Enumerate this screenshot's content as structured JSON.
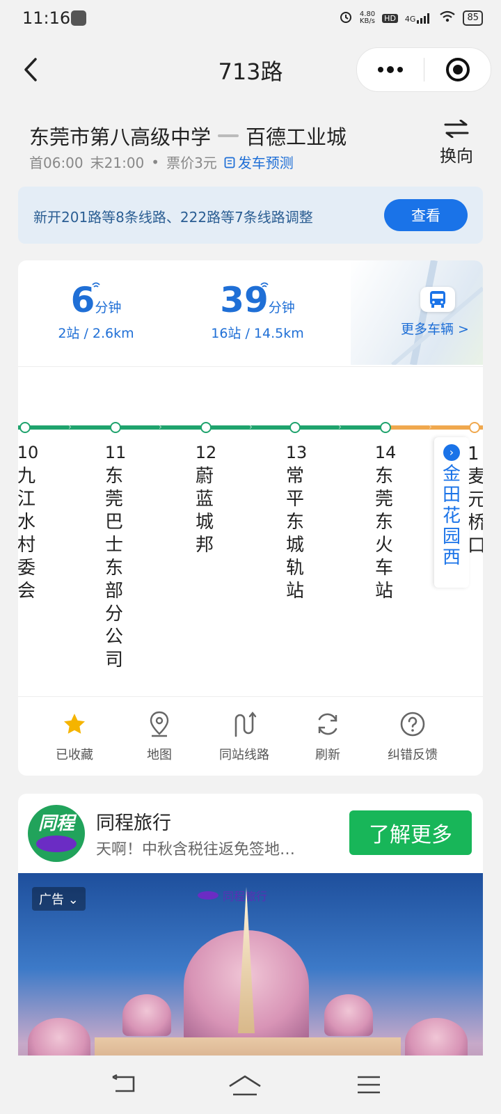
{
  "status_bar": {
    "time": "11:16",
    "net_speed": "4.80\nKB/s",
    "hd": "HD",
    "network": "4G",
    "battery": "85"
  },
  "header": {
    "title": "713路"
  },
  "route": {
    "from": "东莞市第八高级中学",
    "to": "百德工业城",
    "first_bus": "首06:00",
    "last_bus": "末21:00",
    "dot": "•",
    "fare": "票价3元",
    "forecast_label": "发车预测",
    "swap_label": "换向"
  },
  "notice": {
    "text": "新开201路等8条线路、222路等7条线路调整",
    "button": "查看"
  },
  "arrivals": [
    {
      "minutes": "6",
      "unit": "分钟",
      "detail": "2站 / 2.6km"
    },
    {
      "minutes": "39",
      "unit": "分钟",
      "detail": "16站 / 14.5km"
    }
  ],
  "more_buses": "更多车辆 >",
  "stops": [
    {
      "no": "10",
      "name": "九江水村委会"
    },
    {
      "no": "11",
      "name": "东莞巴士东部分公司"
    },
    {
      "no": "12",
      "name": "蔚蓝城邦"
    },
    {
      "no": "13",
      "name": "常平东城轨站"
    },
    {
      "no": "14",
      "name": "东莞东火车站"
    }
  ],
  "next_stop": {
    "name": "金田花园西",
    "clipped_text": "1麦元桥口"
  },
  "actions": [
    {
      "label": "已收藏",
      "icon": "star-icon"
    },
    {
      "label": "地图",
      "icon": "map-pin-icon"
    },
    {
      "label": "同站线路",
      "icon": "route-icon"
    },
    {
      "label": "刷新",
      "icon": "refresh-icon"
    },
    {
      "label": "纠错反馈",
      "icon": "help-icon"
    }
  ],
  "ad": {
    "logo_text": "同程",
    "title": "同程旅行",
    "desc": "天啊！中秋含税往返免签地…",
    "button": "了解更多",
    "tag": "广告",
    "brand": "同程旅行"
  },
  "colors": {
    "accent_blue": "#1a73e8",
    "route_green": "#1fa36d",
    "route_orange": "#f0a84e",
    "ad_green": "#18b659"
  }
}
